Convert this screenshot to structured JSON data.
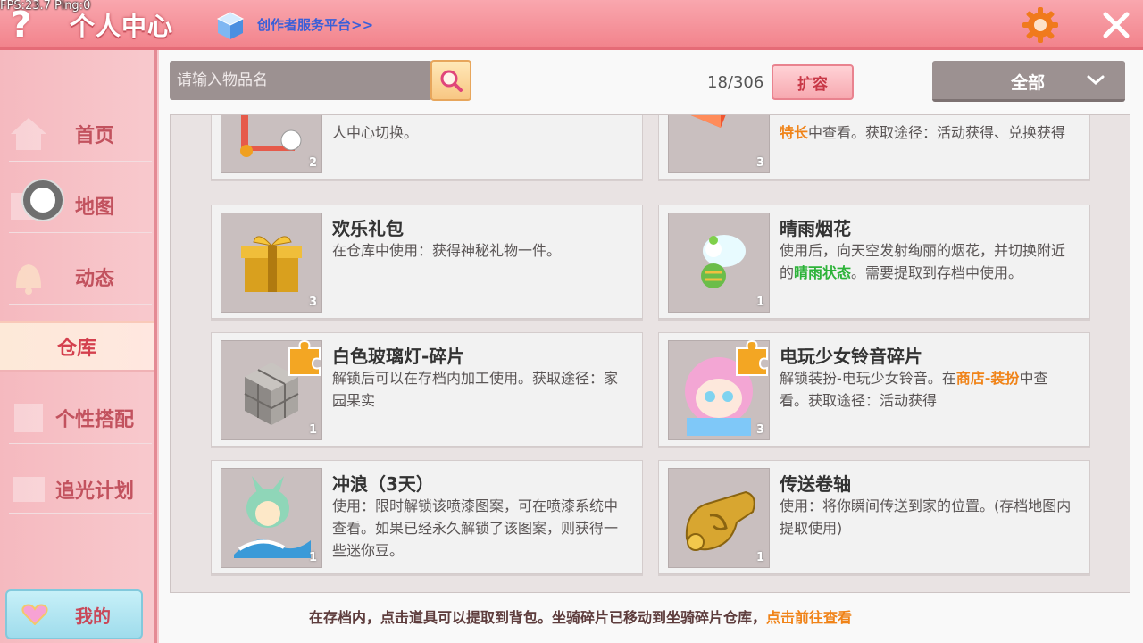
{
  "debug": {
    "fps_text": "FPS:23.7  Ping:0"
  },
  "header": {
    "title": "个人中心",
    "creator_link": "创作者服务平台>>"
  },
  "sidebar": {
    "items": [
      {
        "label": "首页"
      },
      {
        "label": "地图"
      },
      {
        "label": "动态"
      },
      {
        "label": "仓库"
      },
      {
        "label": "个性搭配"
      },
      {
        "label": "追光计划"
      }
    ],
    "active": "仓库",
    "mine_label": "我的"
  },
  "toolbar": {
    "search_placeholder": "请输入物品名",
    "capacity": "18/306",
    "expand_label": "扩容",
    "filter_value": "全部"
  },
  "items": [
    {
      "name": "",
      "desc_parts": [
        [
          "人中心切换。",
          ""
        ]
      ],
      "qty": "2"
    },
    {
      "name": "",
      "desc_parts": [
        [
          "特长",
          "orange"
        ],
        [
          "中查看。获取途径：活动获得、兑换获得",
          ""
        ]
      ],
      "qty": "3"
    },
    {
      "name": "欢乐礼包",
      "desc_parts": [
        [
          "在仓库中使用：获得神秘礼物一件。",
          ""
        ]
      ],
      "qty": "3"
    },
    {
      "name": "晴雨烟花",
      "desc_parts": [
        [
          "使用后，向天空发射绚丽的烟花，并切换附近的",
          ""
        ],
        [
          "晴雨状态",
          "green"
        ],
        [
          "。需要提取到存档中使用。",
          ""
        ]
      ],
      "qty": "1"
    },
    {
      "name": "白色玻璃灯-碎片",
      "desc_parts": [
        [
          "解锁后可以在存档内加工使用。获取途径：家园果实",
          ""
        ]
      ],
      "qty": "1"
    },
    {
      "name": "电玩少女铃音碎片",
      "desc_parts": [
        [
          "解锁装扮-电玩少女铃音。在",
          ""
        ],
        [
          "商店-装扮",
          "orange"
        ],
        [
          "中查看。获取途径：活动获得",
          ""
        ]
      ],
      "qty": "3"
    },
    {
      "name": "冲浪（3天）",
      "desc_parts": [
        [
          "使用：限时解锁该喷漆图案，可在喷漆系统中查看。如果已经永久解锁了该图案，则获得一些迷你豆。",
          ""
        ]
      ],
      "qty": "1"
    },
    {
      "name": "传送卷轴",
      "desc_parts": [
        [
          "使用：将你瞬间传送到家的位置。(存档地图内提取使用)",
          ""
        ]
      ],
      "qty": "1"
    }
  ],
  "footer": {
    "note": "在存档内，点击道具可以提取到背包。坐骑碎片已移动到坐骑碎片仓库，",
    "link": "点击前往查看"
  }
}
